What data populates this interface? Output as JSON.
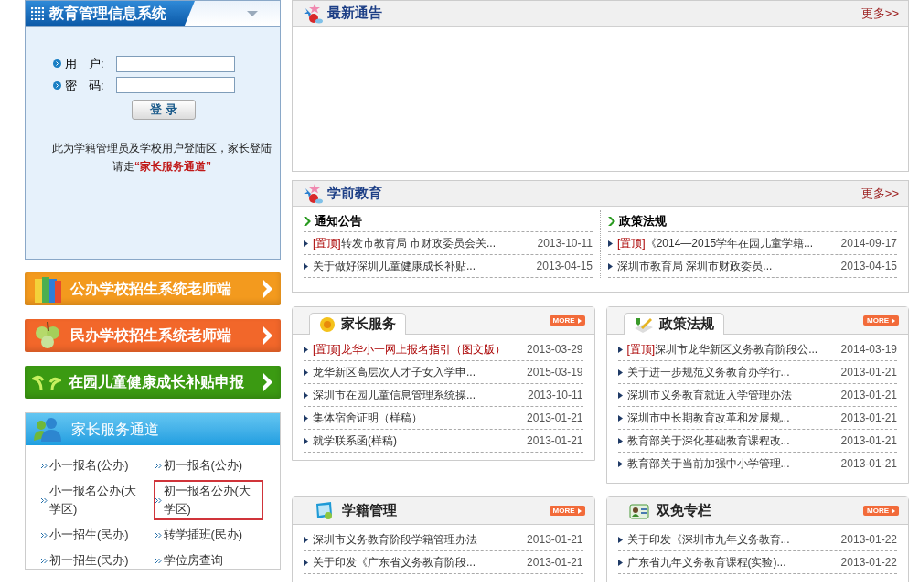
{
  "login": {
    "title": "教育管理信息系统",
    "fields": [
      {
        "label": "用　户:"
      },
      {
        "label": "密　码:"
      }
    ],
    "button": "登 录",
    "note": "此为学籍管理员及学校用户登陆区，家长登陆请走",
    "note_link": "“家长服务通道”"
  },
  "banners": [
    {
      "label": "公办学校招生系统老师端",
      "kind": "books",
      "color": "#f39a1e"
    },
    {
      "label": "民办学校招生系统老师端",
      "kind": "clover",
      "color": "#f2672a"
    },
    {
      "label": "在园儿童健康成长补贴申报",
      "kind": "sprout",
      "color": "#3b9a12"
    }
  ],
  "parent_channel": {
    "title": "家长服务通道",
    "links": [
      {
        "label": "小一报名(公办)",
        "selected": false
      },
      {
        "label": "初一报名(公办)",
        "selected": false
      },
      {
        "label": "小一报名公办(大学区)",
        "selected": false
      },
      {
        "label": "初一报名公办(大学区)",
        "selected": true
      },
      {
        "label": "小一招生(民办)",
        "selected": false
      },
      {
        "label": "转学插班(民办)",
        "selected": false
      },
      {
        "label": "初一招生(民办)",
        "selected": false
      },
      {
        "label": "学位房查询",
        "selected": false
      }
    ]
  },
  "latest_notices": {
    "title": "最新通告",
    "more": "更多>>"
  },
  "preschool": {
    "title": "学前教育",
    "more": "更多>>",
    "columns": [
      {
        "title": "通知公告",
        "items": [
          {
            "tag": "[置顶]",
            "text": "转发市教育局 市财政委员会关...",
            "date": "2013-10-11"
          },
          {
            "text": "关于做好深圳儿童健康成长补贴...",
            "date": "2013-04-15"
          }
        ]
      },
      {
        "title": "政策法规",
        "items": [
          {
            "tag": "[置顶]",
            "text": "《2014—2015学年在园儿童学籍...",
            "date": "2014-09-17"
          },
          {
            "text": "深圳市教育局 深圳市财政委员...",
            "date": "2013-04-15"
          }
        ]
      }
    ]
  },
  "boxes": [
    {
      "title": "家长服务",
      "kind": "tab",
      "more": "MORE",
      "items": [
        {
          "tag": "[置顶]",
          "text": "龙华小一网上报名指引（图文版）",
          "highlight": true,
          "date": "2013-03-29"
        },
        {
          "text": "龙华新区高层次人才子女入学申...",
          "date": "2015-03-19"
        },
        {
          "text": "深圳市在园儿童信息管理系统操...",
          "date": "2013-10-11"
        },
        {
          "text": "集体宿舍证明（样稿）",
          "date": "2013-01-21"
        },
        {
          "text": "就学联系函(样稿)",
          "date": "2013-01-21"
        }
      ]
    },
    {
      "title": "政策法规",
      "kind": "tab",
      "more": "MORE",
      "items": [
        {
          "tag": "[置顶]",
          "text": "深圳市龙华新区义务教育阶段公...",
          "date": "2014-03-19"
        },
        {
          "text": "关于进一步规范义务教育办学行...",
          "date": "2013-01-21"
        },
        {
          "text": "深圳市义务教育就近入学管理办法",
          "date": "2013-01-21"
        },
        {
          "text": "深圳市中长期教育改革和发展规...",
          "date": "2013-01-21"
        },
        {
          "text": "教育部关于深化基础教育课程改...",
          "date": "2013-01-21"
        },
        {
          "text": "教育部关于当前加强中小学管理...",
          "date": "2013-01-21"
        }
      ]
    },
    {
      "title": "学籍管理",
      "kind": "flat",
      "more": "MORE",
      "items": [
        {
          "text": "深圳市义务教育阶段学籍管理办法",
          "date": "2013-01-21"
        },
        {
          "text": "关于印发《广东省义务教育阶段...",
          "date": "2013-01-21"
        }
      ]
    },
    {
      "title": "双免专栏",
      "kind": "flat",
      "more": "MORE",
      "items": [
        {
          "text": "关于印发《深圳市九年义务教育...",
          "date": "2013-01-22"
        },
        {
          "text": "广东省九年义务教育课程(实验)...",
          "date": "2013-01-22"
        }
      ]
    }
  ]
}
